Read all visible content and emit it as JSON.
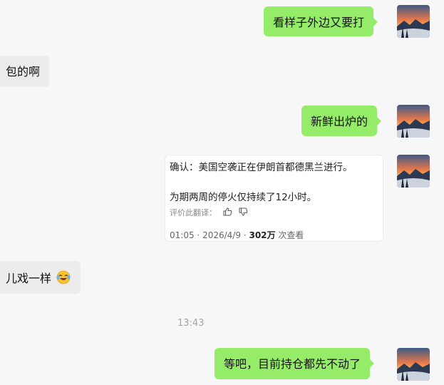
{
  "messages": {
    "m1": "看样子外边又要打",
    "m2": "包的啊",
    "m3": "新鲜出炉的",
    "m5": "儿戏一样",
    "m6": "等吧，目前持仓都先不动了"
  },
  "card": {
    "line1": "确认：美国空袭正在伊朗首都德黑兰进行。",
    "line2": "为期两周的停火仅持续了12小时。",
    "translate_label": "评价此翻译：",
    "time": "01:05",
    "separator1": "·",
    "date": "2026/4/9",
    "separator2": "·",
    "views": "302万",
    "views_suffix": "次查看"
  },
  "timestamp": "13:43",
  "icons": {
    "thumbs_up": "thumbs-up-icon",
    "thumbs_down": "thumbs-down-icon",
    "emoji": "laughing-emoji-icon",
    "avatar": "avatar-sunset-mountain"
  },
  "colors": {
    "my_bubble": "#95ec69",
    "other_bubble": "#ececec",
    "background": "#f7f7f7"
  }
}
